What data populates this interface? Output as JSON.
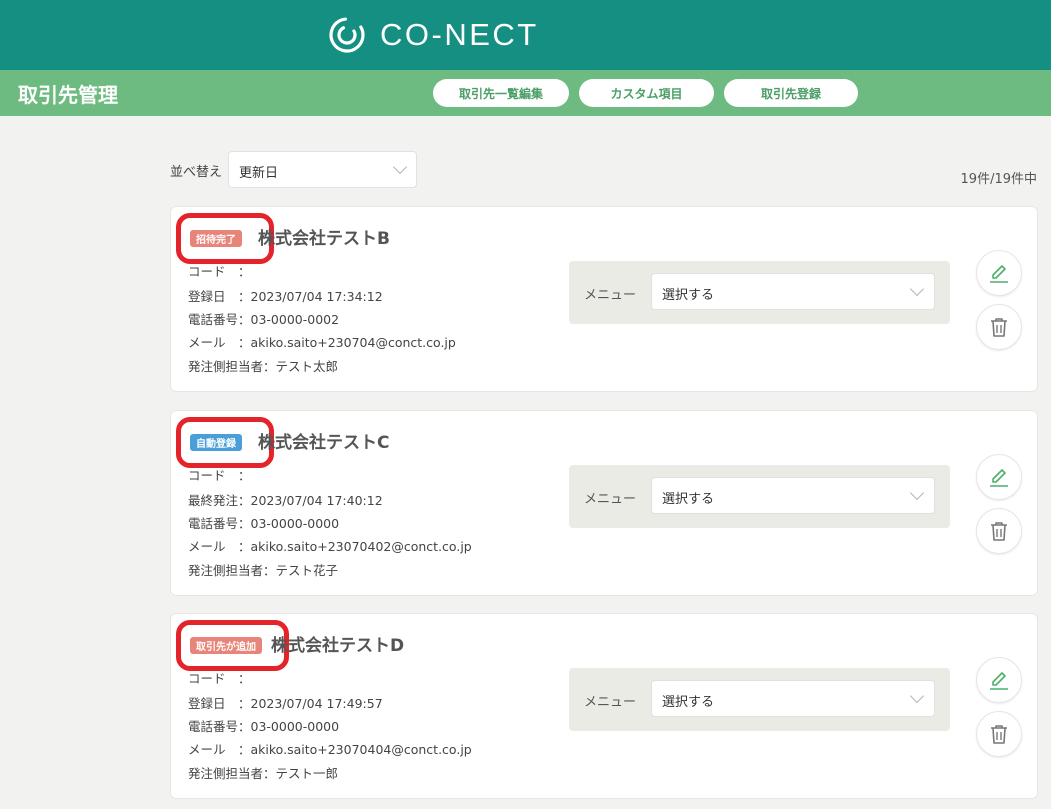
{
  "header": {
    "logo_text": "CO-NECT"
  },
  "subheader": {
    "title": "取引先管理",
    "buttons": [
      {
        "label": "取引先一覧編集"
      },
      {
        "label": "カスタム項目"
      },
      {
        "label": "取引先登録"
      }
    ]
  },
  "toolbar": {
    "sort_label": "並べ替え",
    "sort_value": "更新日",
    "count": "19件/19件中"
  },
  "colors": {
    "header_bg": "#168f83",
    "subheader_bg": "#6dbb80",
    "badge_salmon": "#e8857a",
    "badge_blue": "#4a9fd8",
    "highlight_ring": "#e5232a",
    "edit_icon": "#4caf6a"
  },
  "cards": [
    {
      "badge": "招待完了",
      "badge_color": "#e8857a",
      "name": "株式会社テストB",
      "fields": [
        "コード　：",
        "登録日　：2023/07/04 17:34:12",
        "電話番号：03-0000-0002",
        "メール　：akiko.saito+230704@conct.co.jp",
        "発注側担当者：テスト太郎"
      ],
      "menu_label": "メニュー",
      "menu_value": "選択する"
    },
    {
      "badge": "自動登録",
      "badge_color": "#4a9fd8",
      "name": "株式会社テストC",
      "fields": [
        "コード　：",
        "最終発注：2023/07/04 17:40:12",
        "電話番号：03-0000-0000",
        "メール　：akiko.saito+23070402@conct.co.jp",
        "発注側担当者：テスト花子"
      ],
      "menu_label": "メニュー",
      "menu_value": "選択する"
    },
    {
      "badge": "取引先が追加",
      "badge_color": "#e8857a",
      "name": "株式会社テストD",
      "fields": [
        "コード　：",
        "登録日　：2023/07/04 17:49:57",
        "電話番号：03-0000-0000",
        "メール　：akiko.saito+23070404@conct.co.jp",
        "発注側担当者：テスト一郎"
      ],
      "menu_label": "メニュー",
      "menu_value": "選択する"
    }
  ],
  "icons": {
    "logo": "co-nect-logo-icon",
    "edit": "pencil-icon",
    "delete": "trash-icon",
    "dropdown": "chevron-down-icon"
  }
}
